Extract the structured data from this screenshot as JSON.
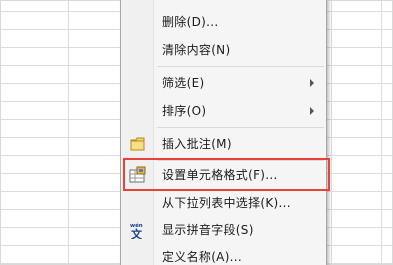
{
  "menu": {
    "items": [
      {
        "label": "删除(D)...",
        "submenu": false
      },
      {
        "label": "清除内容(N)",
        "submenu": false
      },
      {
        "label": "筛选(E)",
        "submenu": true
      },
      {
        "label": "排序(O)",
        "submenu": true
      },
      {
        "label": "插入批注(M)",
        "submenu": false,
        "icon": "comment-icon"
      },
      {
        "label": "设置单元格格式(F)...",
        "submenu": false,
        "icon": "format-cells-icon",
        "highlighted": true
      },
      {
        "label": "从下拉列表中选择(K)...",
        "submenu": false
      },
      {
        "label": "显示拼音字段(S)",
        "submenu": false,
        "icon": "phonetic-icon"
      },
      {
        "label": "定义名称(A)...",
        "submenu": false
      }
    ]
  },
  "colors": {
    "highlight_border": "#e8413a",
    "menu_background": "#f5f5f5"
  }
}
